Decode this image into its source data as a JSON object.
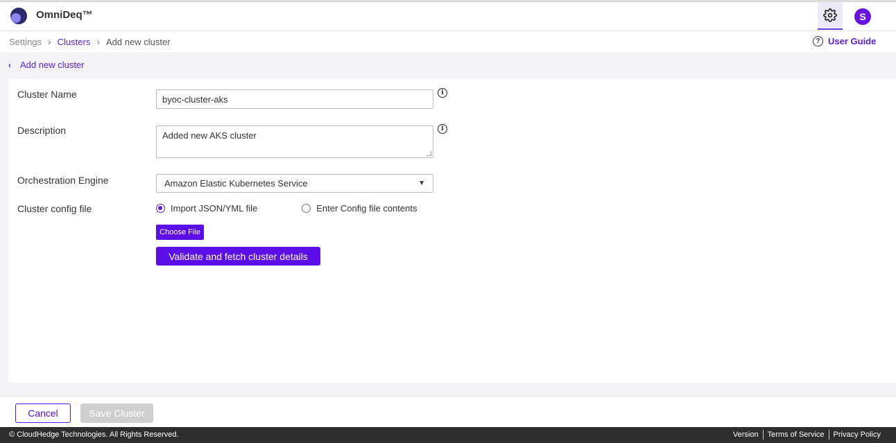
{
  "app": {
    "brand": "OmniDeq™"
  },
  "header": {
    "settings_icon": "gear-icon",
    "avatar_initial": "S"
  },
  "breadcrumb": {
    "settings": "Settings",
    "clusters": "Clusters",
    "current": "Add new cluster"
  },
  "user_guide": {
    "label": "User Guide",
    "icon": "question-circle-icon"
  },
  "back_link": {
    "label": "Add new cluster"
  },
  "form": {
    "cluster_name": {
      "label": "Cluster Name",
      "value": "byoc-cluster-aks"
    },
    "description": {
      "label": "Description",
      "value": "Added new AKS cluster"
    },
    "orchestration_engine": {
      "label": "Orchestration Engine",
      "value": "Amazon Elastic Kubernetes Service"
    },
    "config_file": {
      "label": "Cluster config file",
      "option_import": "Import JSON/YML file",
      "option_enter": "Enter Config file contents",
      "selected": "Import JSON/YML file"
    },
    "choose_file_label": "Choose File",
    "validate_label": "Validate and fetch cluster details"
  },
  "footer": {
    "cancel_label": "Cancel",
    "save_label": "Save Cluster"
  },
  "copyright": {
    "text": "© CloudHedge Technologies. All Rights Reserved.",
    "links": [
      "Version",
      "Terms of Service",
      "Privacy Policy"
    ]
  },
  "colors": {
    "accent": "#5b0ee8",
    "brand_dark": "#2b2a6b",
    "footer_bg": "#2d2d2d"
  }
}
